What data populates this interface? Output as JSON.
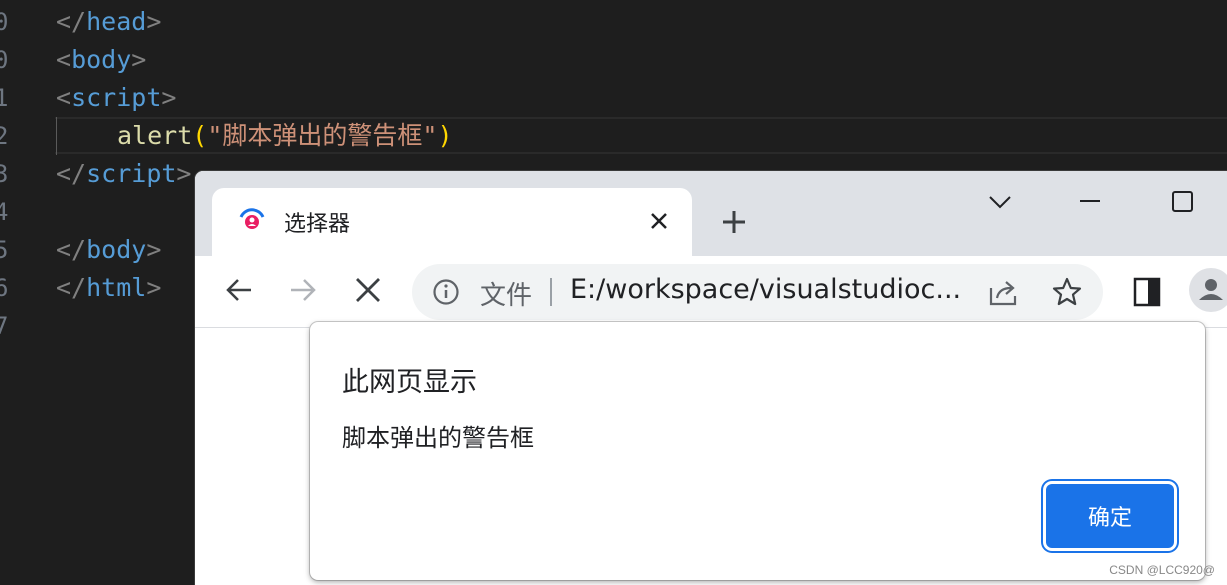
{
  "editor": {
    "gutter": [
      "0",
      "0",
      "1",
      "2",
      "3",
      "4",
      "5",
      "6",
      "7"
    ],
    "lines": {
      "head_close": "head",
      "body_open": "body",
      "script_open": "script",
      "alert_fn": "alert",
      "alert_str": "\"脚本弹出的警告框\"",
      "script_close": "script",
      "body_close": "body",
      "html_close": "html"
    }
  },
  "browser": {
    "tab_title": "选择器",
    "omnibox": {
      "scheme_label": "文件",
      "url": "E:/workspace/visualstudioc..."
    }
  },
  "dialog": {
    "title": "此网页显示",
    "message": "脚本弹出的警告框",
    "ok_label": "确定"
  },
  "watermark": "CSDN @LCC920@",
  "colors": {
    "editor_bg": "#1e1e1e",
    "tag_name": "#569cd6",
    "string": "#ce9178",
    "accent": "#1a73e8",
    "tabstrip": "#dee1e6"
  }
}
